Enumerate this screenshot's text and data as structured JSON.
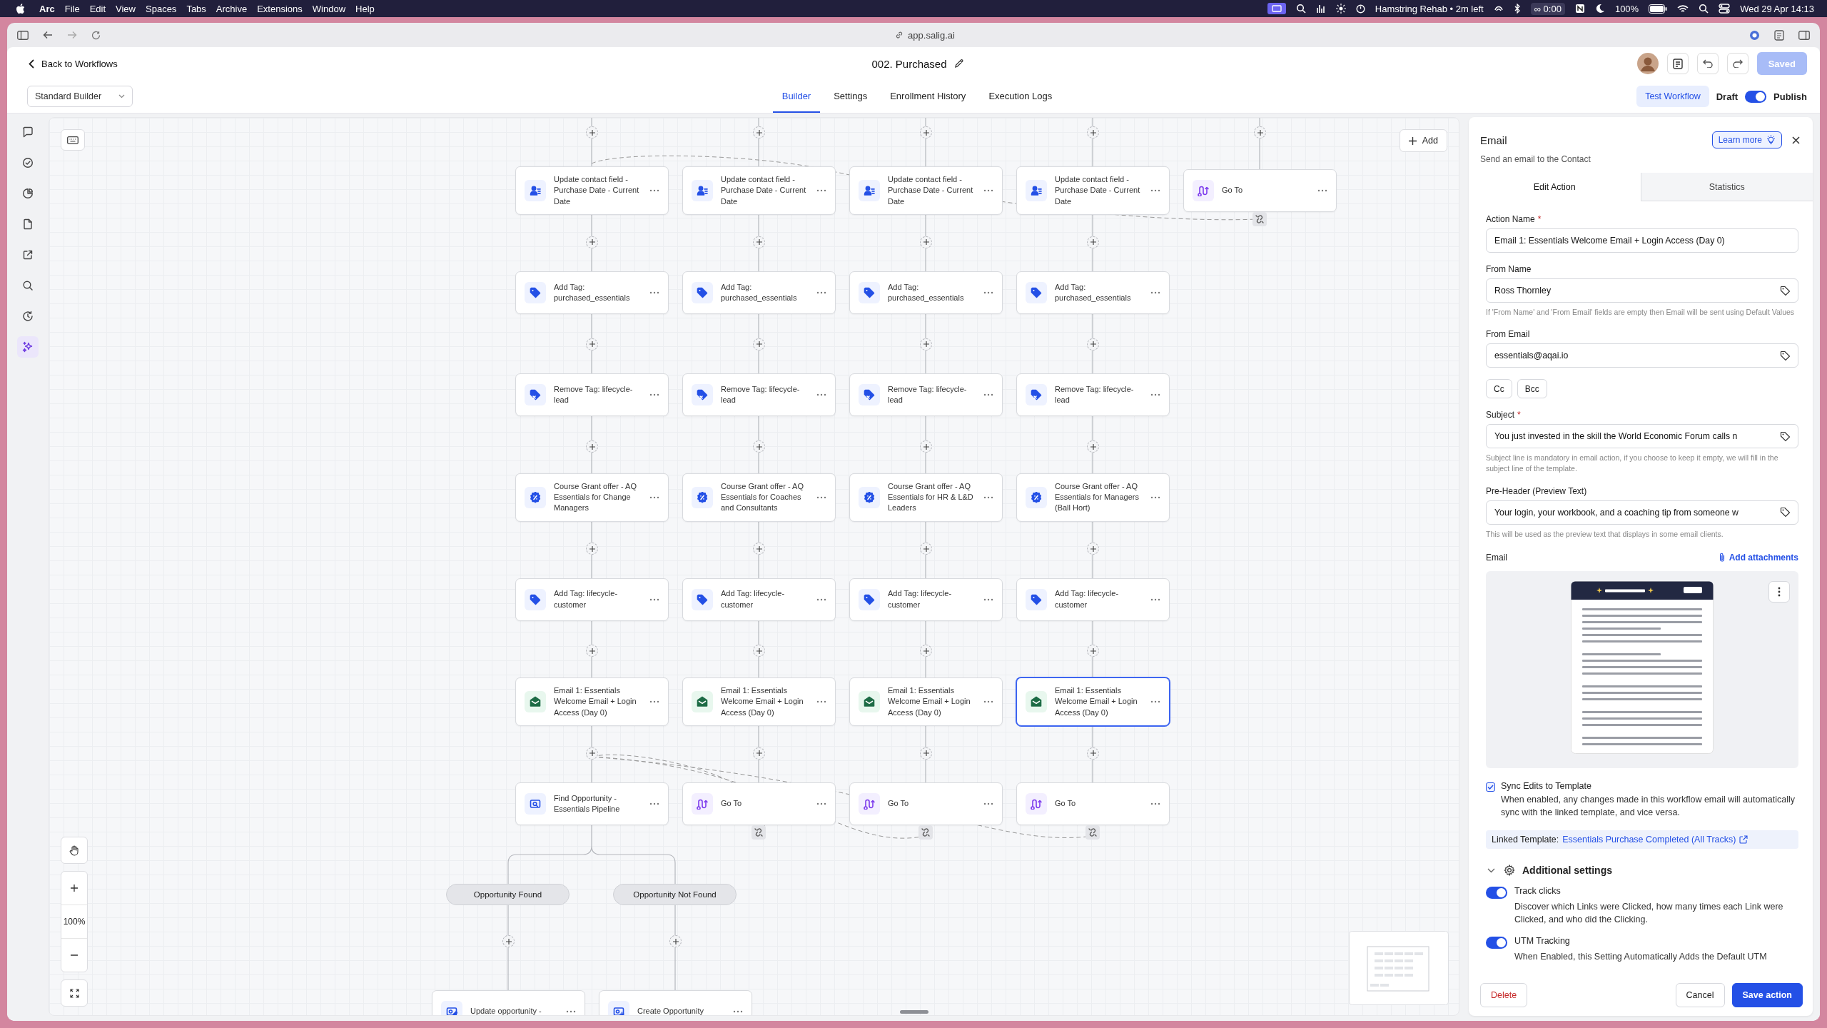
{
  "menubar": {
    "app": "Arc",
    "menus": [
      "File",
      "Edit",
      "View",
      "Spaces",
      "Tabs",
      "Archive",
      "Extensions",
      "Window",
      "Help"
    ],
    "now_playing": "Hamstring Rehab • 2m left",
    "timer": "∞ 0:00",
    "battery": "100%",
    "clock": "Wed 29 Apr 14:13"
  },
  "browser": {
    "url": "app.salig.ai"
  },
  "header": {
    "back": "Back to Workflows",
    "title": "002. Purchased",
    "saved": {
      "label": "Saved",
      "disabled": true
    }
  },
  "toolbar": {
    "builder": "Standard Builder",
    "tabs": [
      {
        "label": "Builder",
        "selected": true
      },
      {
        "label": "Settings",
        "selected": false
      },
      {
        "label": "Enrollment History",
        "selected": false
      },
      {
        "label": "Execution Logs",
        "selected": false
      }
    ],
    "test": "Test Workflow",
    "draft": {
      "label": "Draft",
      "on": true,
      "publish": "Publish"
    }
  },
  "rail": [
    {
      "selected": false
    },
    {
      "selected": false
    },
    {
      "selected": false
    },
    {
      "selected": false
    },
    {
      "selected": false
    },
    {
      "selected": false
    },
    {
      "selected": false
    },
    {
      "selected": true
    }
  ],
  "canvas": {
    "add": "Add",
    "zoom": "100%",
    "columns": [
      {
        "steps": [
          {
            "kind": "contact-field",
            "title": "Update contact field - Purchase Date - Current Date",
            "selected": false
          },
          {
            "kind": "add-tag",
            "title": "Add Tag: purchased_essentials",
            "selected": false
          },
          {
            "kind": "remove-tag",
            "title": "Remove Tag: lifecycle-lead",
            "selected": false
          },
          {
            "kind": "offer",
            "title": "Course Grant offer - AQ Essentials for Change Managers",
            "selected": false
          },
          {
            "kind": "add-tag",
            "title": "Add Tag: lifecycle-customer",
            "selected": false
          },
          {
            "kind": "email",
            "title": "Email 1: Essentials Welcome Email + Login Access (Day 0)",
            "selected": false
          },
          {
            "kind": "find",
            "title": "Find Opportunity - Essentials Pipeline",
            "selected": false
          }
        ]
      },
      {
        "steps": [
          {
            "kind": "contact-field",
            "title": "Update contact field - Purchase Date - Current Date",
            "selected": false
          },
          {
            "kind": "add-tag",
            "title": "Add Tag: purchased_essentials",
            "selected": false
          },
          {
            "kind": "remove-tag",
            "title": "Remove Tag: lifecycle-lead",
            "selected": false
          },
          {
            "kind": "offer",
            "title": "Course Grant offer - AQ Essentials for Coaches and Consultants",
            "selected": false
          },
          {
            "kind": "add-tag",
            "title": "Add Tag: lifecycle-customer",
            "selected": false
          },
          {
            "kind": "email",
            "title": "Email 1: Essentials Welcome Email + Login Access (Day 0)",
            "selected": false
          },
          {
            "kind": "goto",
            "title": "Go To",
            "selected": false
          }
        ]
      },
      {
        "steps": [
          {
            "kind": "contact-field",
            "title": "Update contact field - Purchase Date - Current Date",
            "selected": false
          },
          {
            "kind": "add-tag",
            "title": "Add Tag: purchased_essentials",
            "selected": false
          },
          {
            "kind": "remove-tag",
            "title": "Remove Tag: lifecycle-lead",
            "selected": false
          },
          {
            "kind": "offer",
            "title": "Course Grant offer - AQ Essentials for HR & L&D Leaders",
            "selected": false
          },
          {
            "kind": "add-tag",
            "title": "Add Tag: lifecycle-customer",
            "selected": false
          },
          {
            "kind": "email",
            "title": "Email 1: Essentials Welcome Email + Login Access (Day 0)",
            "selected": false
          },
          {
            "kind": "goto",
            "title": "Go To",
            "selected": false
          }
        ]
      },
      {
        "steps": [
          {
            "kind": "contact-field",
            "title": "Update contact field - Purchase Date - Current Date",
            "selected": false
          },
          {
            "kind": "add-tag",
            "title": "Add Tag: purchased_essentials",
            "selected": false
          },
          {
            "kind": "remove-tag",
            "title": "Remove Tag: lifecycle-lead",
            "selected": false
          },
          {
            "kind": "offer",
            "title": "Course Grant offer - AQ Essentials for Managers (Ball Hort)",
            "selected": false
          },
          {
            "kind": "add-tag",
            "title": "Add Tag: lifecycle-customer",
            "selected": false
          },
          {
            "kind": "email",
            "title": "Email 1: Essentials Welcome Email + Login Access (Day 0)",
            "selected": true
          },
          {
            "kind": "goto",
            "title": "Go To",
            "selected": false
          }
        ]
      },
      {
        "steps": [
          {
            "kind": "goto",
            "title": "Go To",
            "selected": false
          }
        ]
      }
    ],
    "branches": [
      {
        "label": "Opportunity Found",
        "steps": [
          {
            "kind": "update-opportunity",
            "title": "Update opportunity -",
            "selected": false
          }
        ]
      },
      {
        "label": "Opportunity Not Found",
        "steps": [
          {
            "kind": "create-opportunity",
            "title": "Create Opportunity",
            "selected": false
          }
        ]
      }
    ]
  },
  "panel": {
    "title": "Email",
    "learn_more": "Learn more",
    "subtitle": "Send an email to the Contact",
    "tabs": [
      {
        "label": "Edit Action",
        "selected": true
      },
      {
        "label": "Statistics",
        "selected": false
      }
    ],
    "fields": [
      {
        "kind": "plain",
        "label": "Action Name",
        "required_mark": "*",
        "value": "Email 1: Essentials Welcome Email + Login Access (Day 0)"
      },
      {
        "kind": "tagged",
        "label": "From Name",
        "value": "Ross Thornley",
        "hint": "If 'From Name' and 'From Email' fields are empty then Email will be sent using Default Values"
      },
      {
        "kind": "tagged",
        "label": "From Email",
        "value": "essentials@aqai.io"
      },
      {
        "kind": "buttons",
        "buttons": [
          "Cc",
          "Bcc"
        ]
      },
      {
        "kind": "tagged",
        "label": "Subject",
        "required_mark": "*",
        "value": "You just invested in the skill the World Economic Forum calls n",
        "hint": "Subject line is mandatory in email action, if you choose to keep it empty, we will fill in the subject line of the template."
      },
      {
        "kind": "tagged",
        "label": "Pre-Header (Preview Text)",
        "value": "Your login, your workbook, and a coaching tip from someone w",
        "hint": "This will be used as the preview text that displays in some email clients."
      }
    ],
    "email": {
      "label": "Email",
      "attach": "Add attachments"
    },
    "sync": {
      "checked": true,
      "label": "Sync Edits to Template",
      "description": "When enabled, any changes made in this workflow email will automatically sync with the linked template, and vice versa."
    },
    "linked": {
      "label": "Linked Template:",
      "name": "Essentials Purchase Completed (All Tracks)"
    },
    "additional": {
      "title": "Additional settings",
      "expanded": true,
      "toggles": [
        {
          "label": "Track clicks",
          "on": true,
          "description": "Discover which Links were Clicked, how many times each Link were Clicked, and who did the Clicking."
        },
        {
          "label": "UTM Tracking",
          "on": true,
          "description": "When Enabled, this Setting Automatically Adds the Default UTM"
        }
      ]
    },
    "footer": {
      "delete": "Delete",
      "cancel": "Cancel",
      "save": "Save action"
    }
  }
}
